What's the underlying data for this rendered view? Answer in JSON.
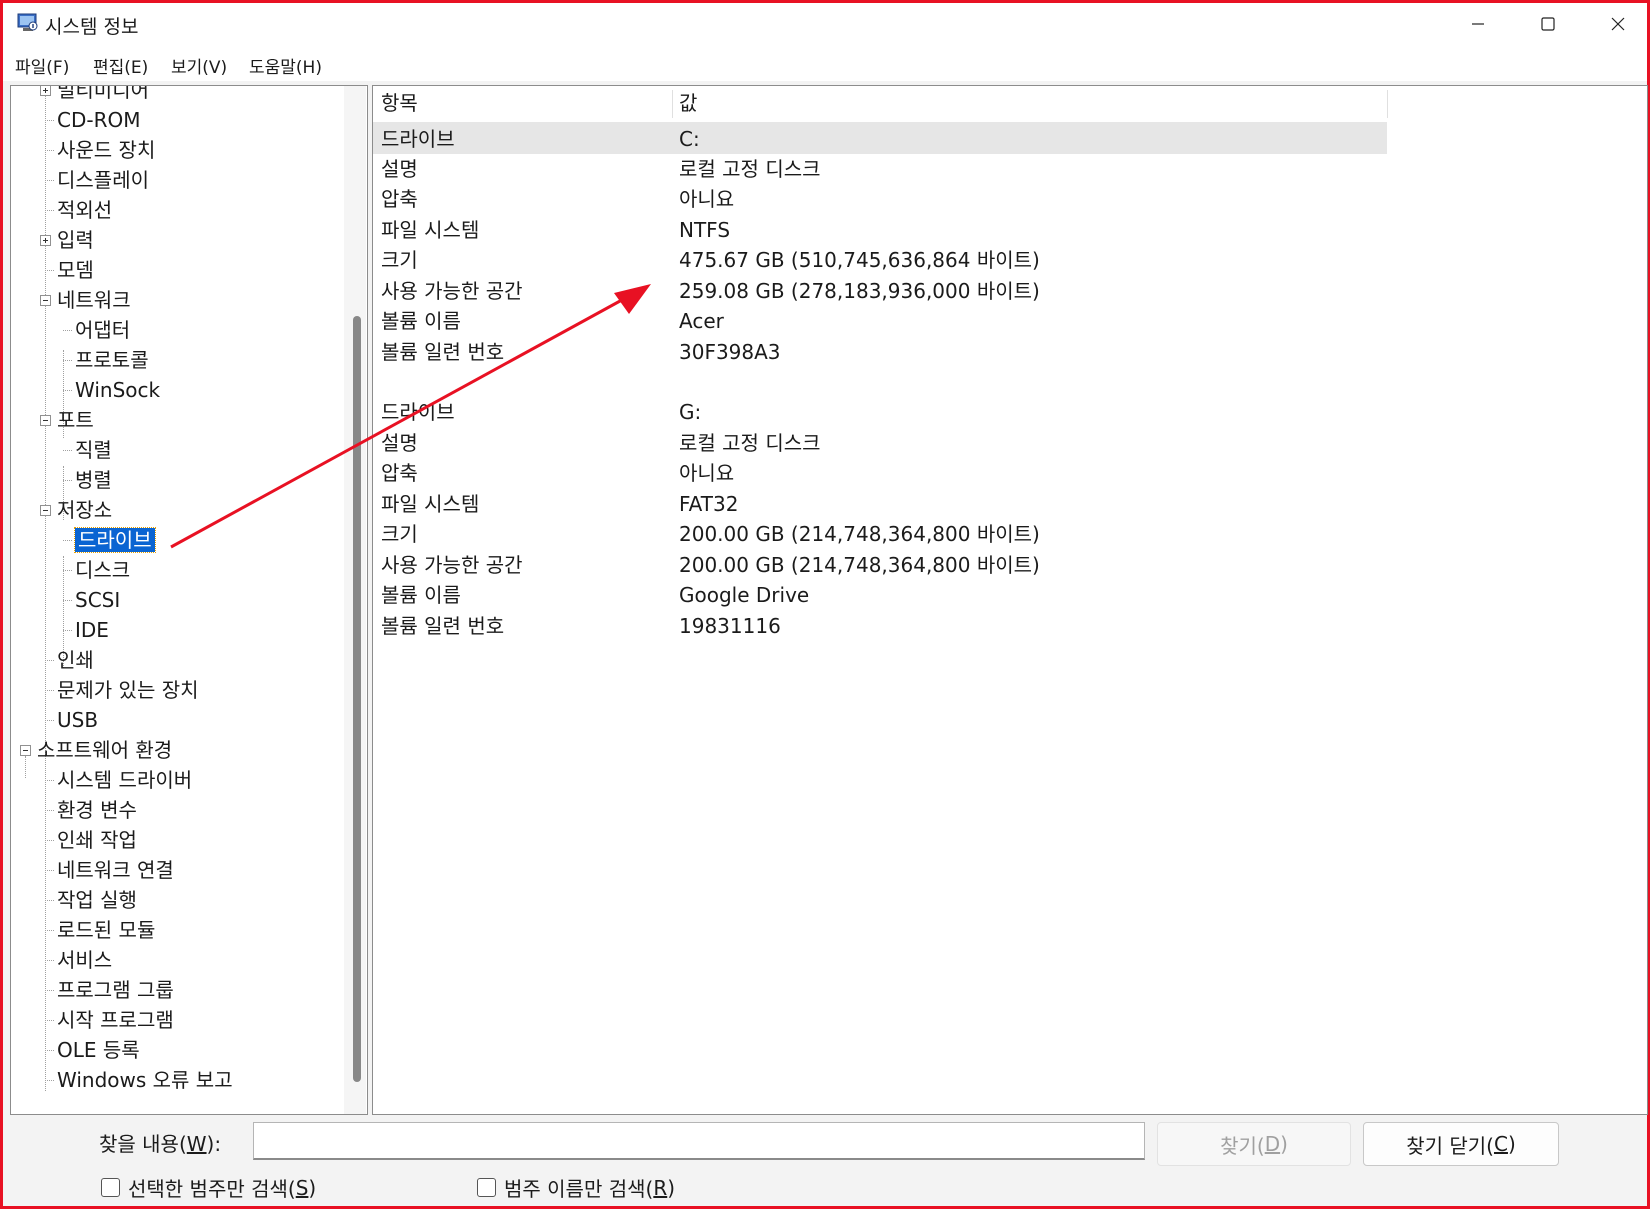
{
  "window": {
    "title": "시스템 정보"
  },
  "menu": [
    "파일(F)",
    "편집(E)",
    "보기(V)",
    "도움말(H)"
  ],
  "tree": [
    {
      "label": "멀티미디어",
      "expander": "plus"
    },
    {
      "label": "CD-ROM"
    },
    {
      "label": "사운드 장치"
    },
    {
      "label": "디스플레이"
    },
    {
      "label": "적외선"
    },
    {
      "label": "입력",
      "expander": "plus"
    },
    {
      "label": "모뎀"
    },
    {
      "label": "네트워크",
      "expander": "minus"
    },
    {
      "label": "어댑터"
    },
    {
      "label": "프로토콜"
    },
    {
      "label": "WinSock"
    },
    {
      "label": "포트",
      "expander": "minus"
    },
    {
      "label": "직렬"
    },
    {
      "label": "병렬"
    },
    {
      "label": "저장소",
      "expander": "minus"
    },
    {
      "label": "드라이브",
      "selected": true
    },
    {
      "label": "디스크"
    },
    {
      "label": "SCSI"
    },
    {
      "label": "IDE"
    },
    {
      "label": "인쇄"
    },
    {
      "label": "문제가 있는 장치"
    },
    {
      "label": "USB"
    },
    {
      "label": "소프트웨어 환경",
      "expander": "minus"
    },
    {
      "label": "시스템 드라이버"
    },
    {
      "label": "환경 변수"
    },
    {
      "label": "인쇄 작업"
    },
    {
      "label": "네트워크 연결"
    },
    {
      "label": "작업 실행"
    },
    {
      "label": "로드된 모듈"
    },
    {
      "label": "서비스"
    },
    {
      "label": "프로그램 그룹"
    },
    {
      "label": "시작 프로그램"
    },
    {
      "label": "OLE 등록"
    },
    {
      "label": "Windows 오류 보고"
    }
  ],
  "details": {
    "columns": [
      "항목",
      "값"
    ],
    "rows": [
      [
        "드라이브",
        "C:"
      ],
      [
        "설명",
        "로컬 고정 디스크"
      ],
      [
        "압축",
        "아니요"
      ],
      [
        "파일 시스템",
        "NTFS"
      ],
      [
        "크기",
        "475.67 GB (510,745,636,864 바이트)"
      ],
      [
        "사용 가능한 공간",
        "259.08 GB (278,183,936,000 바이트)"
      ],
      [
        "볼륨 이름",
        "Acer"
      ],
      [
        "볼륨 일련 번호",
        "30F398A3"
      ],
      [
        "",
        ""
      ],
      [
        "드라이브",
        "G:"
      ],
      [
        "설명",
        "로컬 고정 디스크"
      ],
      [
        "압축",
        "아니요"
      ],
      [
        "파일 시스템",
        "FAT32"
      ],
      [
        "크기",
        "200.00 GB (214,748,364,800 바이트)"
      ],
      [
        "사용 가능한 공간",
        "200.00 GB (214,748,364,800 바이트)"
      ],
      [
        "볼륨 이름",
        "Google Drive"
      ],
      [
        "볼륨 일련 번호",
        "19831116"
      ]
    ]
  },
  "search": {
    "label_prefix": "찾을 내용(",
    "label_key": "W",
    "label_suffix": "):",
    "value": "",
    "find_prefix": "찾기(",
    "find_key": "D",
    "find_suffix": ")",
    "close_prefix": "찾기 닫기(",
    "close_key": "C",
    "close_suffix": ")",
    "chk1_prefix": "선택한 범주만 검색(",
    "chk1_key": "S",
    "chk1_suffix": ")",
    "chk2_prefix": "범주 이름만 검색(",
    "chk2_key": "R",
    "chk2_suffix": ")"
  },
  "annotation_color": "#e81123",
  "selection_color": "#0a64d2"
}
